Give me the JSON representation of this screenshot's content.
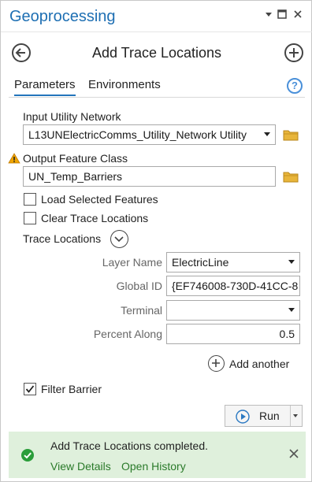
{
  "window": {
    "title": "Geoprocessing"
  },
  "tool": {
    "title": "Add Trace Locations"
  },
  "tabs": {
    "parameters": "Parameters",
    "environments": "Environments",
    "help": "?"
  },
  "params": {
    "input_network_label": "Input Utility Network",
    "input_network_value": "L13UNElectricComms_Utility_Network Utility",
    "output_class_label": "Output Feature Class",
    "output_class_value": "UN_Temp_Barriers",
    "load_selected_label": "Load Selected Features",
    "load_selected_checked": false,
    "clear_trace_label": "Clear Trace Locations",
    "clear_trace_checked": false,
    "trace_locations_label": "Trace Locations",
    "layer_name_label": "Layer Name",
    "layer_name_value": "ElectricLine",
    "global_id_label": "Global ID",
    "global_id_value": "{EF746008-730D-41CC-8",
    "terminal_label": "Terminal",
    "terminal_value": "",
    "percent_along_label": "Percent Along",
    "percent_along_value": "0.5",
    "add_another_label": "Add another",
    "filter_barrier_label": "Filter Barrier",
    "filter_barrier_checked": true
  },
  "run": {
    "label": "Run"
  },
  "message": {
    "text": "Add Trace Locations completed.",
    "view_details": "View Details",
    "open_history": "Open History"
  },
  "colors": {
    "title_blue": "#1e6fb3",
    "success_bg": "#dff0dc",
    "success_icon": "#2a9d3a",
    "link_green": "#2a7a2a",
    "warning": "#f0a500"
  }
}
